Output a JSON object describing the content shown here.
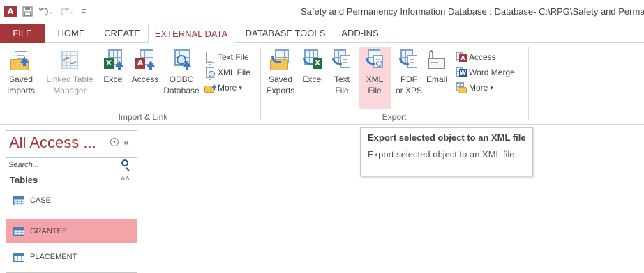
{
  "window": {
    "title": "Safety and Permanency Information Database : Database- C:\\RPG\\Safety and Permanency",
    "app_icon": "A",
    "qat": [
      "save-icon",
      "undo-icon",
      "redo-icon",
      "customize-icon"
    ]
  },
  "tabs": [
    {
      "label": "FILE"
    },
    {
      "label": "HOME"
    },
    {
      "label": "CREATE"
    },
    {
      "label": "EXTERNAL DATA"
    },
    {
      "label": "DATABASE TOOLS"
    },
    {
      "label": "ADD-INS"
    }
  ],
  "ribbon": {
    "import_link": {
      "group_label": "Import & Link",
      "saved_imports": {
        "line1": "Saved",
        "line2": "Imports"
      },
      "linked_table_manager": {
        "line1": "Linked Table",
        "line2": "Manager"
      },
      "excel": {
        "line1": "Excel"
      },
      "access": {
        "line1": "Access"
      },
      "odbc": {
        "line1": "ODBC",
        "line2": "Database"
      },
      "text_file": "Text File",
      "xml_file": "XML File",
      "more": "More"
    },
    "export": {
      "group_label": "Export",
      "saved_exports": {
        "line1": "Saved",
        "line2": "Exports"
      },
      "excel": {
        "line1": "Excel"
      },
      "text_file": {
        "line1": "Text",
        "line2": "File"
      },
      "xml_file": {
        "line1": "XML",
        "line2": "File"
      },
      "pdf_xps": {
        "line1": "PDF",
        "line2": "or XPS"
      },
      "email": {
        "line1": "Email"
      },
      "access": "Access",
      "word_merge": "Word Merge",
      "more": "More"
    },
    "dropdown_arrow": "▾"
  },
  "tooltip": {
    "title": "Export selected object to an XML file",
    "body": "Export selected object to an XML file."
  },
  "nav": {
    "title": "All Access ...",
    "collapse": "«",
    "search_placeholder": "Search...",
    "section": "Tables",
    "section_chevron": "≈",
    "items": [
      {
        "name": "CASE",
        "selected": false
      },
      {
        "name": "GRANTEE",
        "selected": true
      },
      {
        "name": "PLACEMENT",
        "selected": false
      }
    ]
  },
  "colors": {
    "accent": "#a4373a",
    "selected_item": "#f4a3a8",
    "hover_button": "#fbd7db"
  }
}
